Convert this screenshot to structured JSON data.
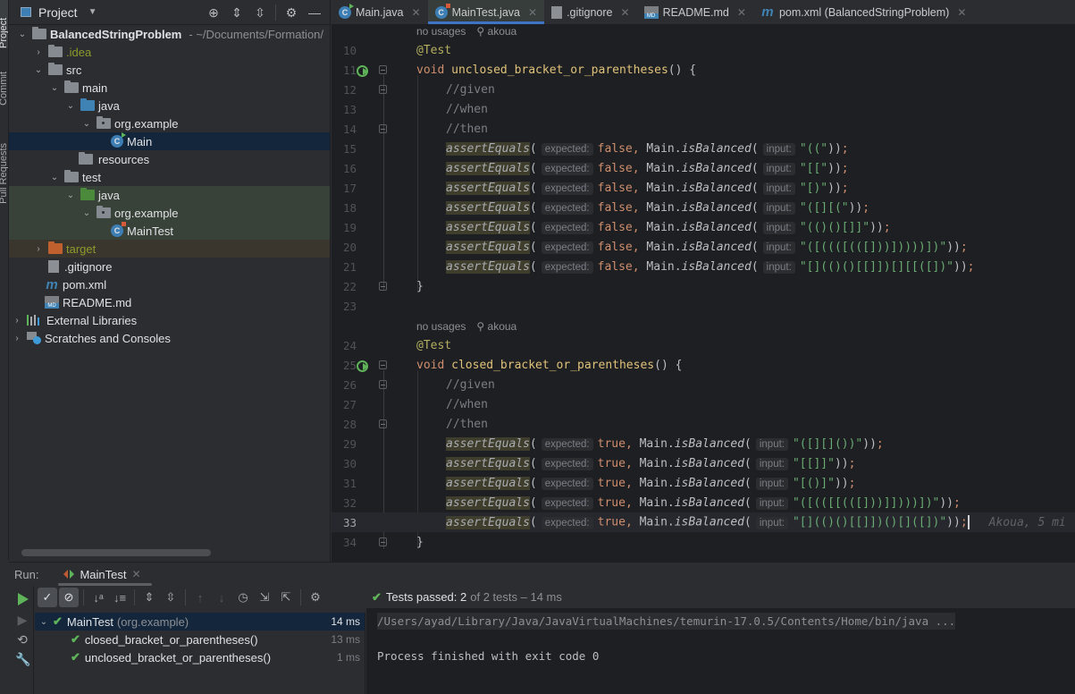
{
  "toolstrip": {
    "items": [
      "Project",
      "Commit",
      "Pull Requests"
    ]
  },
  "project_panel": {
    "title": "Project",
    "tools": [
      "locate-icon",
      "expand-all-icon",
      "collapse-all-icon",
      "gear-icon",
      "minimize-icon"
    ],
    "tree": [
      {
        "label": "BalancedStringProblem",
        "suffix": "- ~/Documents/Formation/",
        "level": 0,
        "expanded": true,
        "icon": "module-folder"
      },
      {
        "label": ".idea",
        "level": 1,
        "expanded": false,
        "icon": "folder"
      },
      {
        "label": "src",
        "level": 1,
        "expanded": true,
        "icon": "folder"
      },
      {
        "label": "main",
        "level": 2,
        "expanded": true,
        "icon": "folder"
      },
      {
        "label": "java",
        "level": 3,
        "expanded": true,
        "icon": "source-folder"
      },
      {
        "label": "org.example",
        "level": 4,
        "expanded": true,
        "icon": "package"
      },
      {
        "label": "Main",
        "level": 5,
        "icon": "class",
        "selected": true
      },
      {
        "label": "resources",
        "level": 3,
        "icon": "resources-folder"
      },
      {
        "label": "test",
        "level": 2,
        "expanded": true,
        "icon": "folder"
      },
      {
        "label": "java",
        "level": 3,
        "expanded": true,
        "icon": "test-folder"
      },
      {
        "label": "org.example",
        "level": 4,
        "expanded": true,
        "icon": "package"
      },
      {
        "label": "MainTest",
        "level": 5,
        "icon": "test-class"
      },
      {
        "label": "target",
        "level": 1,
        "expanded": false,
        "icon": "excluded-folder"
      },
      {
        "label": ".gitignore",
        "level": 1,
        "icon": "gitignore-file"
      },
      {
        "label": "pom.xml",
        "level": 1,
        "icon": "maven-file"
      },
      {
        "label": "README.md",
        "level": 1,
        "icon": "markdown-file"
      },
      {
        "label": "External Libraries",
        "level": 0,
        "expanded": false,
        "icon": "libraries"
      },
      {
        "label": "Scratches and Consoles",
        "level": 0,
        "expanded": false,
        "icon": "scratches"
      }
    ]
  },
  "editor": {
    "tabs": [
      {
        "label": "Main.java",
        "icon": "class",
        "active": false
      },
      {
        "label": "MainTest.java",
        "icon": "test-class",
        "active": true
      },
      {
        "label": ".gitignore",
        "icon": "gitignore-file",
        "active": false
      },
      {
        "label": "README.md",
        "icon": "markdown-file",
        "active": false
      },
      {
        "label": "pom.xml (BalancedStringProblem)",
        "icon": "maven-file",
        "active": false
      }
    ],
    "meta1": {
      "usages": "no usages",
      "author": "akoua"
    },
    "meta2": {
      "usages": "no usages",
      "author": "akoua"
    },
    "annotation": "@Test",
    "kw_void": "void",
    "method1": "unclosed_bracket_or_parentheses",
    "method2": "closed_bracket_or_parentheses",
    "sig_tail": "() {",
    "comments": [
      "//given",
      "//when",
      "//then"
    ],
    "close_brace": "}",
    "assert_fn": "assertEquals",
    "hint_expected": "expected:",
    "hint_input": "input:",
    "call_main": "Main.",
    "call_fn": "isBalanced",
    "false_kw": "false",
    "true_kw": "true",
    "unclosed_inputs": [
      "\"((\"",
      "\"[[\"",
      "\"[)\"",
      "\"([][(\"",
      "\"(()()[]]\"",
      "\"([((([(([]))]))))])\"",
      "\"[](()()[[]])[][[([])\""
    ],
    "closed_inputs": [
      "\"([][]())\"",
      "\"[[]]\"",
      "\"[()]\"",
      "\"([(([[(([]))]])))])\"",
      "\"[](()()[[]])()[]([])\""
    ],
    "line_numbers": {
      "first_block": [
        10,
        11,
        12,
        13,
        14,
        15,
        16,
        17,
        18,
        19,
        20,
        21,
        22,
        23
      ],
      "second_block": [
        24,
        25,
        26,
        27,
        28,
        29,
        30,
        31,
        32,
        33,
        34
      ]
    },
    "current_line": 33,
    "blame_inlay": "Akoua, 5 mi"
  },
  "run_panel": {
    "label": "Run:",
    "tab_label": "MainTest",
    "status": {
      "prefix": "Tests passed:",
      "passed": "2",
      "suffix": "of 2 tests – 14 ms"
    },
    "tests": [
      {
        "name": "MainTest",
        "pkg": "(org.example)",
        "duration": "14 ms",
        "passed": true,
        "root": true
      },
      {
        "name": "closed_bracket_or_parentheses()",
        "duration": "13 ms",
        "passed": true
      },
      {
        "name": "unclosed_bracket_or_parentheses()",
        "duration": "1 ms",
        "passed": true
      }
    ],
    "console": {
      "command": "/Users/ayad/Library/Java/JavaVirtualMachines/temurin-17.0.5/Contents/Home/bin/java ...",
      "exit": "Process finished with exit code 0"
    }
  }
}
